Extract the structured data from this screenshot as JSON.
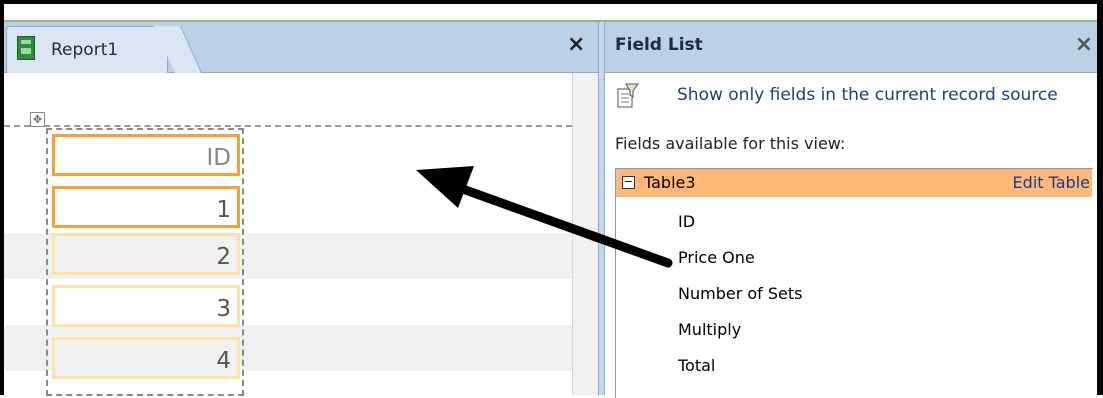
{
  "report": {
    "tab_label": "Report1",
    "close_glyph": "×",
    "anchor_glyph": "✥",
    "column": {
      "header": "ID",
      "values": [
        "1",
        "2",
        "3",
        "4"
      ]
    }
  },
  "field_list": {
    "title": "Field List",
    "close_glyph": "×",
    "filter_label": "Show only fields in the current record source",
    "available_label": "Fields available for this view:",
    "table": {
      "toggle_glyph": "−",
      "name": "Table3",
      "edit_label": "Edit Table",
      "fields": [
        "ID",
        "Price One",
        "Number of Sets",
        "Multiply",
        "Total"
      ]
    }
  },
  "colors": {
    "accent_orange": "#f6a03a",
    "pale_orange": "#fde3a7",
    "header_blue": "#bcd0e6",
    "link_blue": "#1a3d8f",
    "selected_table": "#ffb878",
    "row_stripe": "#f1f1f1"
  },
  "icons": {
    "report_tab": "report-icon",
    "filter": "filter-icon",
    "annotation": "arrow-annotation"
  }
}
